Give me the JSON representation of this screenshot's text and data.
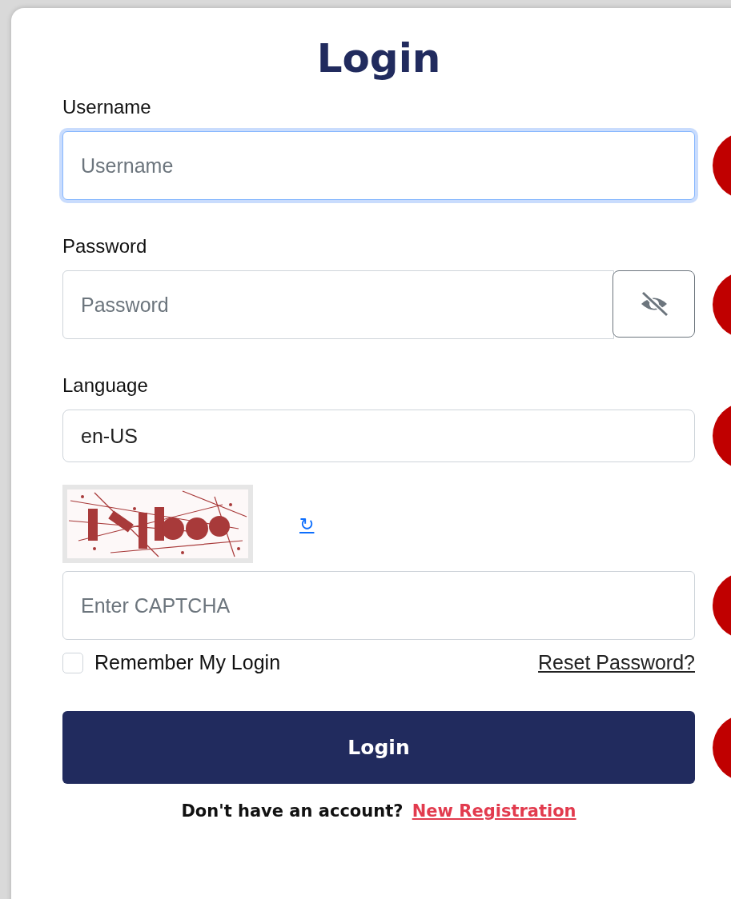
{
  "title": "Login",
  "fields": [
    {
      "kind": "text",
      "label": "Username",
      "placeholder": "Username",
      "focused": true
    },
    {
      "kind": "password",
      "label": "Password",
      "placeholder": "Password",
      "focused": false
    },
    {
      "kind": "select",
      "label": "Language",
      "value": "en-US",
      "focused": false
    },
    {
      "kind": "captcha",
      "refresh": "↻",
      "placeholder": "Enter CAPTCHA",
      "focused": false
    }
  ],
  "remember": {
    "label": "Remember My Login",
    "checked": false
  },
  "reset_link": "Reset Password?",
  "login_button": "Login",
  "footer": {
    "text": "Don't have an account?",
    "link": "New Registration"
  }
}
